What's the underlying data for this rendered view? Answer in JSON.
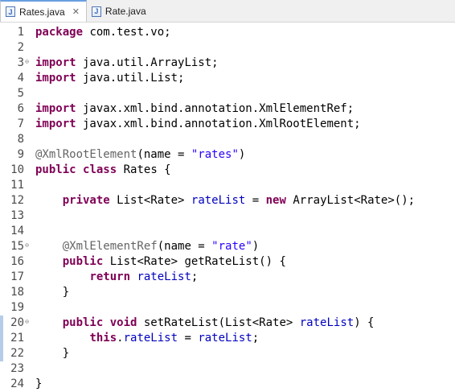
{
  "tabs": [
    {
      "label": "Rates.java",
      "active": true,
      "closable": true,
      "icon": "java-file-icon"
    },
    {
      "label": "Rate.java",
      "active": false,
      "closable": false,
      "icon": "java-file-icon"
    }
  ],
  "editor": {
    "lines": [
      {
        "n": "1",
        "fold": "",
        "tokens": [
          {
            "t": "package",
            "c": "kw"
          },
          {
            "t": " com.test.vo;",
            "c": ""
          }
        ]
      },
      {
        "n": "2",
        "fold": "",
        "tokens": []
      },
      {
        "n": "3",
        "fold": "⊖",
        "tokens": [
          {
            "t": "import",
            "c": "kw"
          },
          {
            "t": " java.util.ArrayList;",
            "c": ""
          }
        ]
      },
      {
        "n": "4",
        "fold": "",
        "tokens": [
          {
            "t": "import",
            "c": "kw"
          },
          {
            "t": " java.util.List;",
            "c": ""
          }
        ]
      },
      {
        "n": "5",
        "fold": "",
        "tokens": []
      },
      {
        "n": "6",
        "fold": "",
        "tokens": [
          {
            "t": "import",
            "c": "kw"
          },
          {
            "t": " javax.xml.bind.annotation.XmlElementRef;",
            "c": ""
          }
        ]
      },
      {
        "n": "7",
        "fold": "",
        "tokens": [
          {
            "t": "import",
            "c": "kw"
          },
          {
            "t": " javax.xml.bind.annotation.XmlRootElement;",
            "c": ""
          }
        ]
      },
      {
        "n": "8",
        "fold": "",
        "tokens": []
      },
      {
        "n": "9",
        "fold": "",
        "tokens": [
          {
            "t": "@XmlRootElement",
            "c": "ann"
          },
          {
            "t": "(name = ",
            "c": ""
          },
          {
            "t": "\"rates\"",
            "c": "str"
          },
          {
            "t": ")",
            "c": ""
          }
        ]
      },
      {
        "n": "10",
        "fold": "",
        "tokens": [
          {
            "t": "public",
            "c": "kw"
          },
          {
            "t": " ",
            "c": ""
          },
          {
            "t": "class",
            "c": "kw"
          },
          {
            "t": " Rates {",
            "c": ""
          }
        ]
      },
      {
        "n": "11",
        "fold": "",
        "tokens": []
      },
      {
        "n": "12",
        "fold": "",
        "tokens": [
          {
            "t": "    ",
            "c": ""
          },
          {
            "t": "private",
            "c": "kw"
          },
          {
            "t": " List<Rate> ",
            "c": ""
          },
          {
            "t": "rateList",
            "c": "fld"
          },
          {
            "t": " = ",
            "c": ""
          },
          {
            "t": "new",
            "c": "kw"
          },
          {
            "t": " ArrayList<Rate>();",
            "c": ""
          }
        ]
      },
      {
        "n": "13",
        "fold": "",
        "tokens": []
      },
      {
        "n": "14",
        "fold": "",
        "tokens": []
      },
      {
        "n": "15",
        "fold": "⊖",
        "tokens": [
          {
            "t": "    ",
            "c": ""
          },
          {
            "t": "@XmlElementRef",
            "c": "ann"
          },
          {
            "t": "(name = ",
            "c": ""
          },
          {
            "t": "\"rate\"",
            "c": "str"
          },
          {
            "t": ")",
            "c": ""
          }
        ]
      },
      {
        "n": "16",
        "fold": "",
        "tokens": [
          {
            "t": "    ",
            "c": ""
          },
          {
            "t": "public",
            "c": "kw"
          },
          {
            "t": " List<Rate> getRateList() {",
            "c": ""
          }
        ]
      },
      {
        "n": "17",
        "fold": "",
        "tokens": [
          {
            "t": "        ",
            "c": ""
          },
          {
            "t": "return",
            "c": "kw"
          },
          {
            "t": " ",
            "c": ""
          },
          {
            "t": "rateList",
            "c": "fld"
          },
          {
            "t": ";",
            "c": ""
          }
        ]
      },
      {
        "n": "18",
        "fold": "",
        "tokens": [
          {
            "t": "    }",
            "c": ""
          }
        ]
      },
      {
        "n": "19",
        "fold": "",
        "tokens": []
      },
      {
        "n": "20",
        "fold": "⊖",
        "tokens": [
          {
            "t": "    ",
            "c": ""
          },
          {
            "t": "public",
            "c": "kw"
          },
          {
            "t": " ",
            "c": ""
          },
          {
            "t": "void",
            "c": "kw"
          },
          {
            "t": " setRateList(List<Rate> ",
            "c": ""
          },
          {
            "t": "rateList",
            "c": "fld"
          },
          {
            "t": ") {",
            "c": ""
          }
        ]
      },
      {
        "n": "21",
        "fold": "",
        "tokens": [
          {
            "t": "        ",
            "c": ""
          },
          {
            "t": "this",
            "c": "kw"
          },
          {
            "t": ".",
            "c": ""
          },
          {
            "t": "rateList",
            "c": "fld"
          },
          {
            "t": " = ",
            "c": ""
          },
          {
            "t": "rateList",
            "c": "fld"
          },
          {
            "t": ";",
            "c": ""
          }
        ]
      },
      {
        "n": "22",
        "fold": "",
        "tokens": [
          {
            "t": "    }",
            "c": ""
          }
        ]
      },
      {
        "n": "23",
        "fold": "",
        "tokens": []
      },
      {
        "n": "24",
        "fold": "",
        "tokens": [
          {
            "t": "}",
            "c": ""
          }
        ]
      }
    ],
    "change_marker_lines": [
      "20",
      "21",
      "22"
    ]
  },
  "colors": {
    "keyword": "#7f0055",
    "annotation": "#646464",
    "string": "#2a00ff",
    "field": "#0000c0",
    "active_tab_accent": "#6a9fe0",
    "change_marker": "#b5cde9"
  }
}
